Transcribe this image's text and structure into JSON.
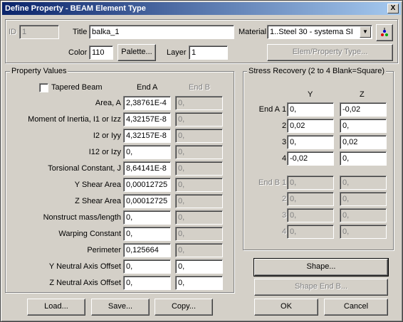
{
  "window": {
    "title": "Define Property - BEAM Element Type",
    "close_label": "X"
  },
  "top": {
    "id_label": "ID",
    "id_value": "1",
    "title_label": "Title",
    "title_value": "balka_1",
    "material_label": "Material",
    "material_value": "1..Steel 30 - systema SI",
    "color_label": "Color",
    "color_value": "110",
    "palette_label": "Palette...",
    "layer_label": "Layer",
    "layer_value": "1",
    "elem_type_label": "Elem/Property Type..."
  },
  "property_values": {
    "group_title": "Property Values",
    "tapered_label": "Tapered Beam",
    "end_a_header": "End A",
    "end_b_header": "End B",
    "rows": [
      {
        "label": "Area,  A",
        "end_a": "2,38761E-4",
        "end_b": "0,"
      },
      {
        "label": "Moment of Inertia,  I1 or Izz",
        "end_a": "4,32157E-8",
        "end_b": "0,"
      },
      {
        "label": "I2 or Iyy",
        "end_a": "4,32157E-8",
        "end_b": "0,"
      },
      {
        "label": "I12 or Izy",
        "end_a": "0,",
        "end_b": "0,"
      },
      {
        "label": "Torsional Constant,  J",
        "end_a": "8,64141E-8",
        "end_b": "0,"
      },
      {
        "label": "Y Shear Area",
        "end_a": "0,00012725",
        "end_b": "0,"
      },
      {
        "label": "Z Shear Area",
        "end_a": "0,00012725",
        "end_b": "0,"
      },
      {
        "label": "Nonstruct mass/length",
        "end_a": "0,",
        "end_b": "0,"
      },
      {
        "label": "Warping Constant",
        "end_a": "0,",
        "end_b": "0,"
      },
      {
        "label": "Perimeter",
        "end_a": "0,125664",
        "end_b": "0,"
      },
      {
        "label": "Y Neutral Axis Offset",
        "end_a": "0,",
        "end_b": "0,"
      },
      {
        "label": "Z Neutral Axis Offset",
        "end_a": "0,",
        "end_b": "0,"
      }
    ]
  },
  "stress_recovery": {
    "group_title": "Stress Recovery (2 to 4 Blank=Square)",
    "y_header": "Y",
    "z_header": "Z",
    "end_a_label": "End A",
    "end_b_label": "End B",
    "end_a": [
      {
        "num": "1",
        "y": "0,",
        "z": "-0,02"
      },
      {
        "num": "2",
        "y": "0,02",
        "z": "0,"
      },
      {
        "num": "3",
        "y": "0,",
        "z": "0,02"
      },
      {
        "num": "4",
        "y": "-0,02",
        "z": "0,"
      }
    ],
    "end_b": [
      {
        "num": "1",
        "y": "0,",
        "z": "0,"
      },
      {
        "num": "2",
        "y": "0,",
        "z": "0,"
      },
      {
        "num": "3",
        "y": "0,",
        "z": "0,"
      },
      {
        "num": "4",
        "y": "0,",
        "z": "0,"
      }
    ]
  },
  "buttons": {
    "shape": "Shape...",
    "shape_end_b": "Shape End B...",
    "load": "Load...",
    "save": "Save...",
    "copy": "Copy...",
    "ok": "OK",
    "cancel": "Cancel"
  }
}
